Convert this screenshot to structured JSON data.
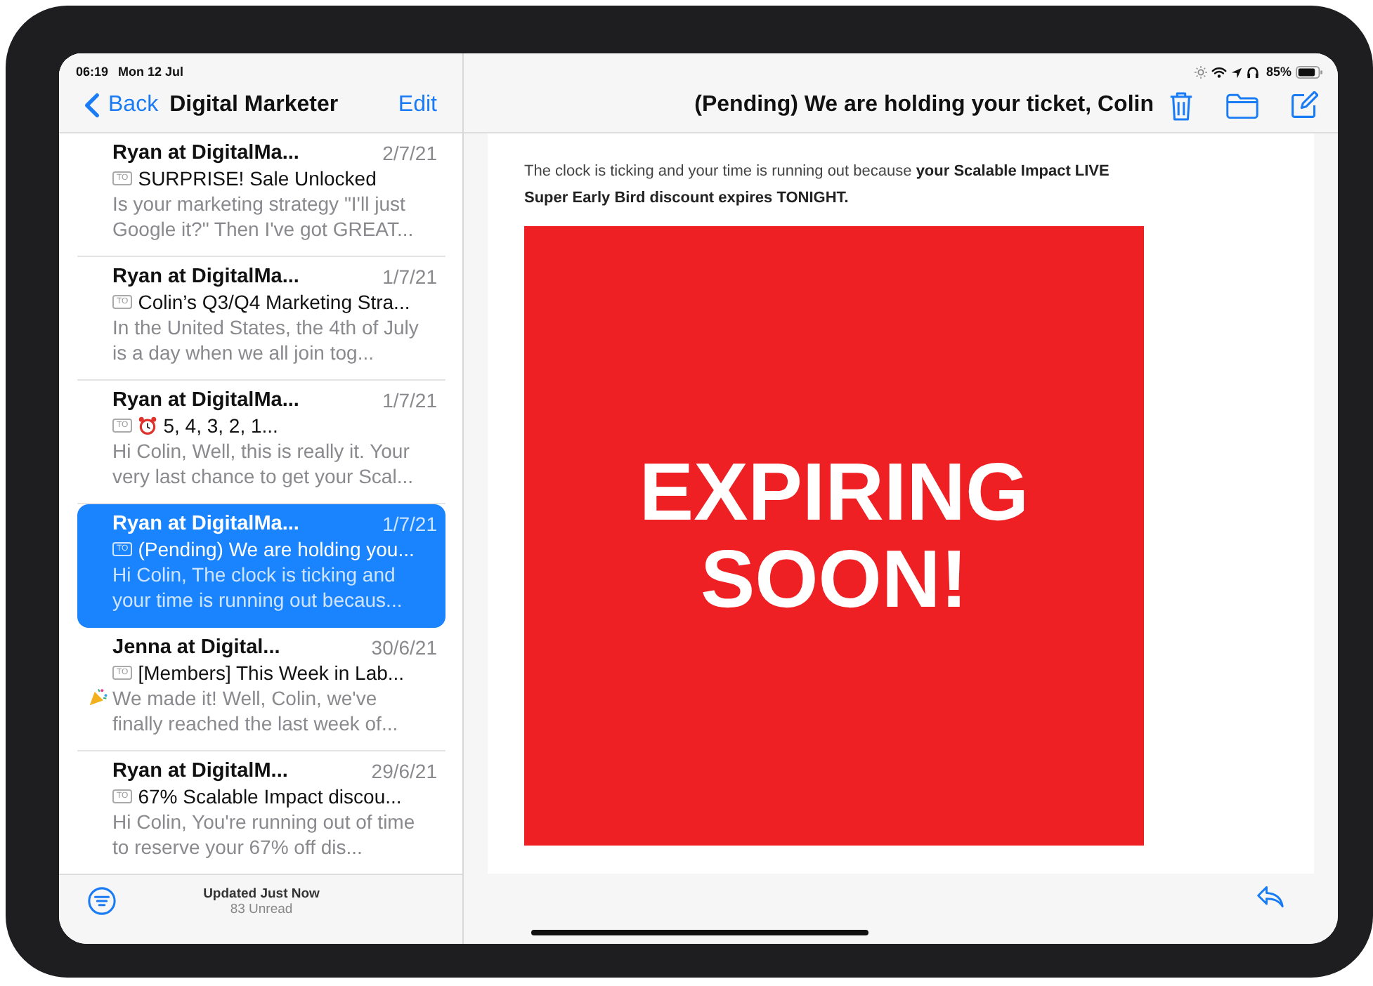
{
  "status_bar": {
    "time": "06:19",
    "date": "Mon 12 Jul",
    "battery_text": "85%"
  },
  "sidebar": {
    "back_label": "Back",
    "title": "Digital Marketer",
    "edit_label": "Edit",
    "messages": [
      {
        "sender": "Ryan at DigitalMa...",
        "date": "2/7/21",
        "to_badge": "TO",
        "kind": "plain",
        "subject": "SURPRISE! Sale Unlocked",
        "preview": "Is your marketing strategy \"I'll just Google it?\" Then I've got GREAT...",
        "selected": false
      },
      {
        "sender": "Ryan at DigitalMa...",
        "date": "1/7/21",
        "to_badge": "TO",
        "kind": "plain",
        "subject": "Colin’s Q3/Q4 Marketing Stra...",
        "preview": "In the United States, the 4th of July is a day when we all join tog...",
        "selected": false
      },
      {
        "sender": "Ryan at DigitalMa...",
        "date": "1/7/21",
        "to_badge": "TO",
        "kind": "alarm",
        "subject": "5, 4, 3, 2, 1...",
        "preview": "Hi Colin, Well, this is really it. Your very last chance to get your Scal...",
        "selected": false
      },
      {
        "sender": "Ryan at DigitalMa...",
        "date": "1/7/21",
        "to_badge": "TO",
        "kind": "plain",
        "subject": "(Pending) We are holding you...",
        "preview": "Hi Colin, The clock is ticking and your time is running out becaus...",
        "selected": true
      },
      {
        "sender": "Jenna at Digital...",
        "date": "30/6/21",
        "to_badge": "TO",
        "kind": "party",
        "subject": "[Members] This Week in Lab...",
        "preview": "We made it! Well, Colin, we've finally reached the last week of...",
        "selected": false
      },
      {
        "sender": "Ryan at DigitalM...",
        "date": "29/6/21",
        "to_badge": "TO",
        "kind": "plain",
        "subject": "67% Scalable Impact discou...",
        "preview": "Hi Colin, You're running out of time to reserve your 67% off dis...",
        "selected": false
      }
    ],
    "footer": {
      "updated": "Updated Just Now",
      "unread": "83 Unread"
    }
  },
  "message": {
    "title": "(Pending) We are holding your ticket, Colin",
    "intro": "The clock is ticking and your time is running out because **your Scalable Impact LIVE Super Early Bird discount expires TONIGHT.**",
    "banner_text": "EXPIRING SOON!"
  }
}
